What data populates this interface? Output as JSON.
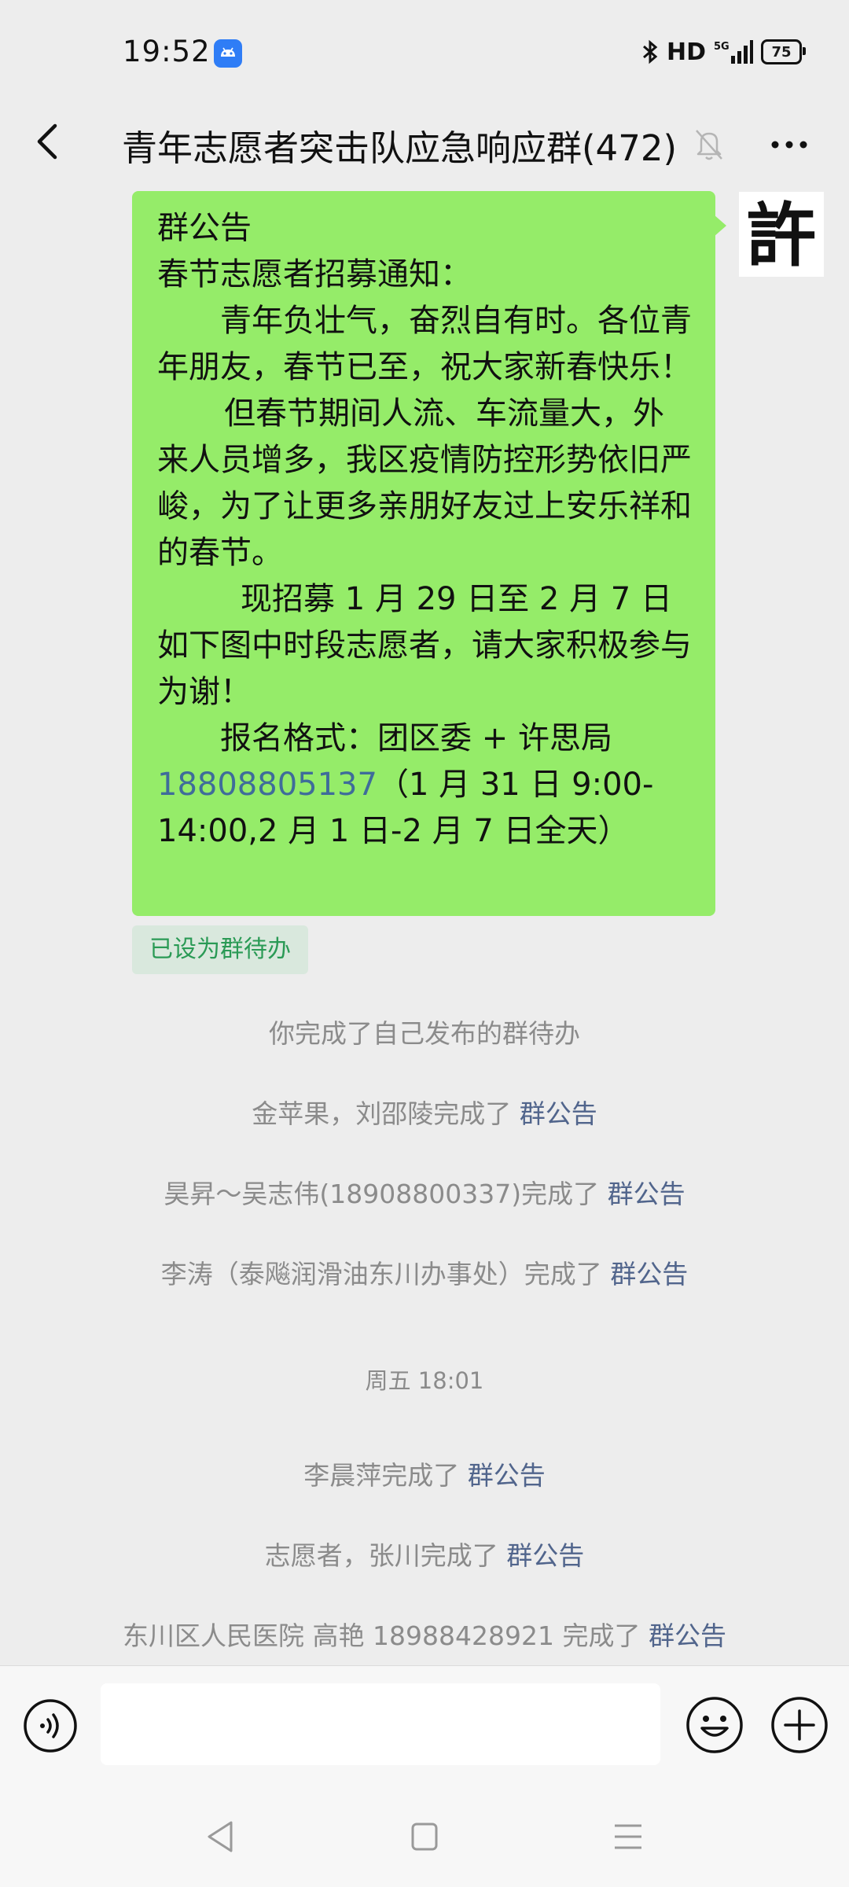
{
  "status_bar": {
    "time": "19:52",
    "network": "HD",
    "battery": "75"
  },
  "header": {
    "title": "青年志愿者突击队应急响应群(472)"
  },
  "message": {
    "heading": "群公告",
    "subheading": "春节志愿者招募通知：",
    "para1": "青年负壮气，奋烈自有时。各位青年朋友，春节已至，祝大家新春快乐！",
    "para2": "但春节期间人流、车流量大，外来人员增多，我区疫情防控形势依旧严峻，为了让更多亲朋好友过上安乐祥和的春节。",
    "para3": "现招募 1 月 29 日至 2 月 7 日如下图中时段志愿者，请大家积极参与为谢！",
    "para4_prefix": "报名格式：团区委 + 许思局",
    "phone": "18808805137",
    "para4_suffix": "（1 月 31 日 9:00-14:00,2 月 1 日-2 月 7 日全天）",
    "tag": "已设为群待办",
    "avatar_glyph": "許"
  },
  "system_messages": [
    {
      "text": "你完成了自己发布的群待办",
      "link": ""
    },
    {
      "text": "金苹果，刘邵陵完成了 ",
      "link": "群公告"
    },
    {
      "text": "昊昇～吴志伟(18908800337)完成了 ",
      "link": "群公告"
    },
    {
      "text": "李涛（泰飚润滑油东川办事处）完成了 ",
      "link": "群公告"
    },
    {
      "text": "李晨萍完成了 ",
      "link": "群公告"
    },
    {
      "text": "志愿者，张川完成了 ",
      "link": "群公告"
    },
    {
      "text": "东川区人民医院  高艳 18988428921 完成了 ",
      "link": "群公告"
    }
  ],
  "timestamp": "周五 18:01",
  "input": {
    "placeholder": ""
  }
}
